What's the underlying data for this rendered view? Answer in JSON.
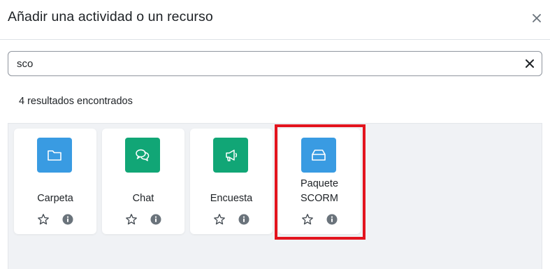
{
  "modal": {
    "title": "Añadir una actividad o un recurso",
    "close_icon": "close-icon"
  },
  "search": {
    "value": "sco",
    "placeholder": "Buscar",
    "clear_icon": "clear-icon"
  },
  "results": {
    "count_text": "4 resultados encontrados"
  },
  "colors": {
    "blue_icon": "#399be2",
    "green_icon": "#11a676",
    "highlight": "#e3141e"
  },
  "items": [
    {
      "label": "Carpeta",
      "icon": "folder-icon",
      "color": "#399be2"
    },
    {
      "label": "Chat",
      "icon": "chat-icon",
      "color": "#11a676"
    },
    {
      "label": "Encuesta",
      "icon": "megaphone-icon",
      "color": "#11a676"
    },
    {
      "label_line1": "Paquete",
      "label_line2": "SCORM",
      "icon": "package-icon",
      "color": "#399be2"
    }
  ]
}
